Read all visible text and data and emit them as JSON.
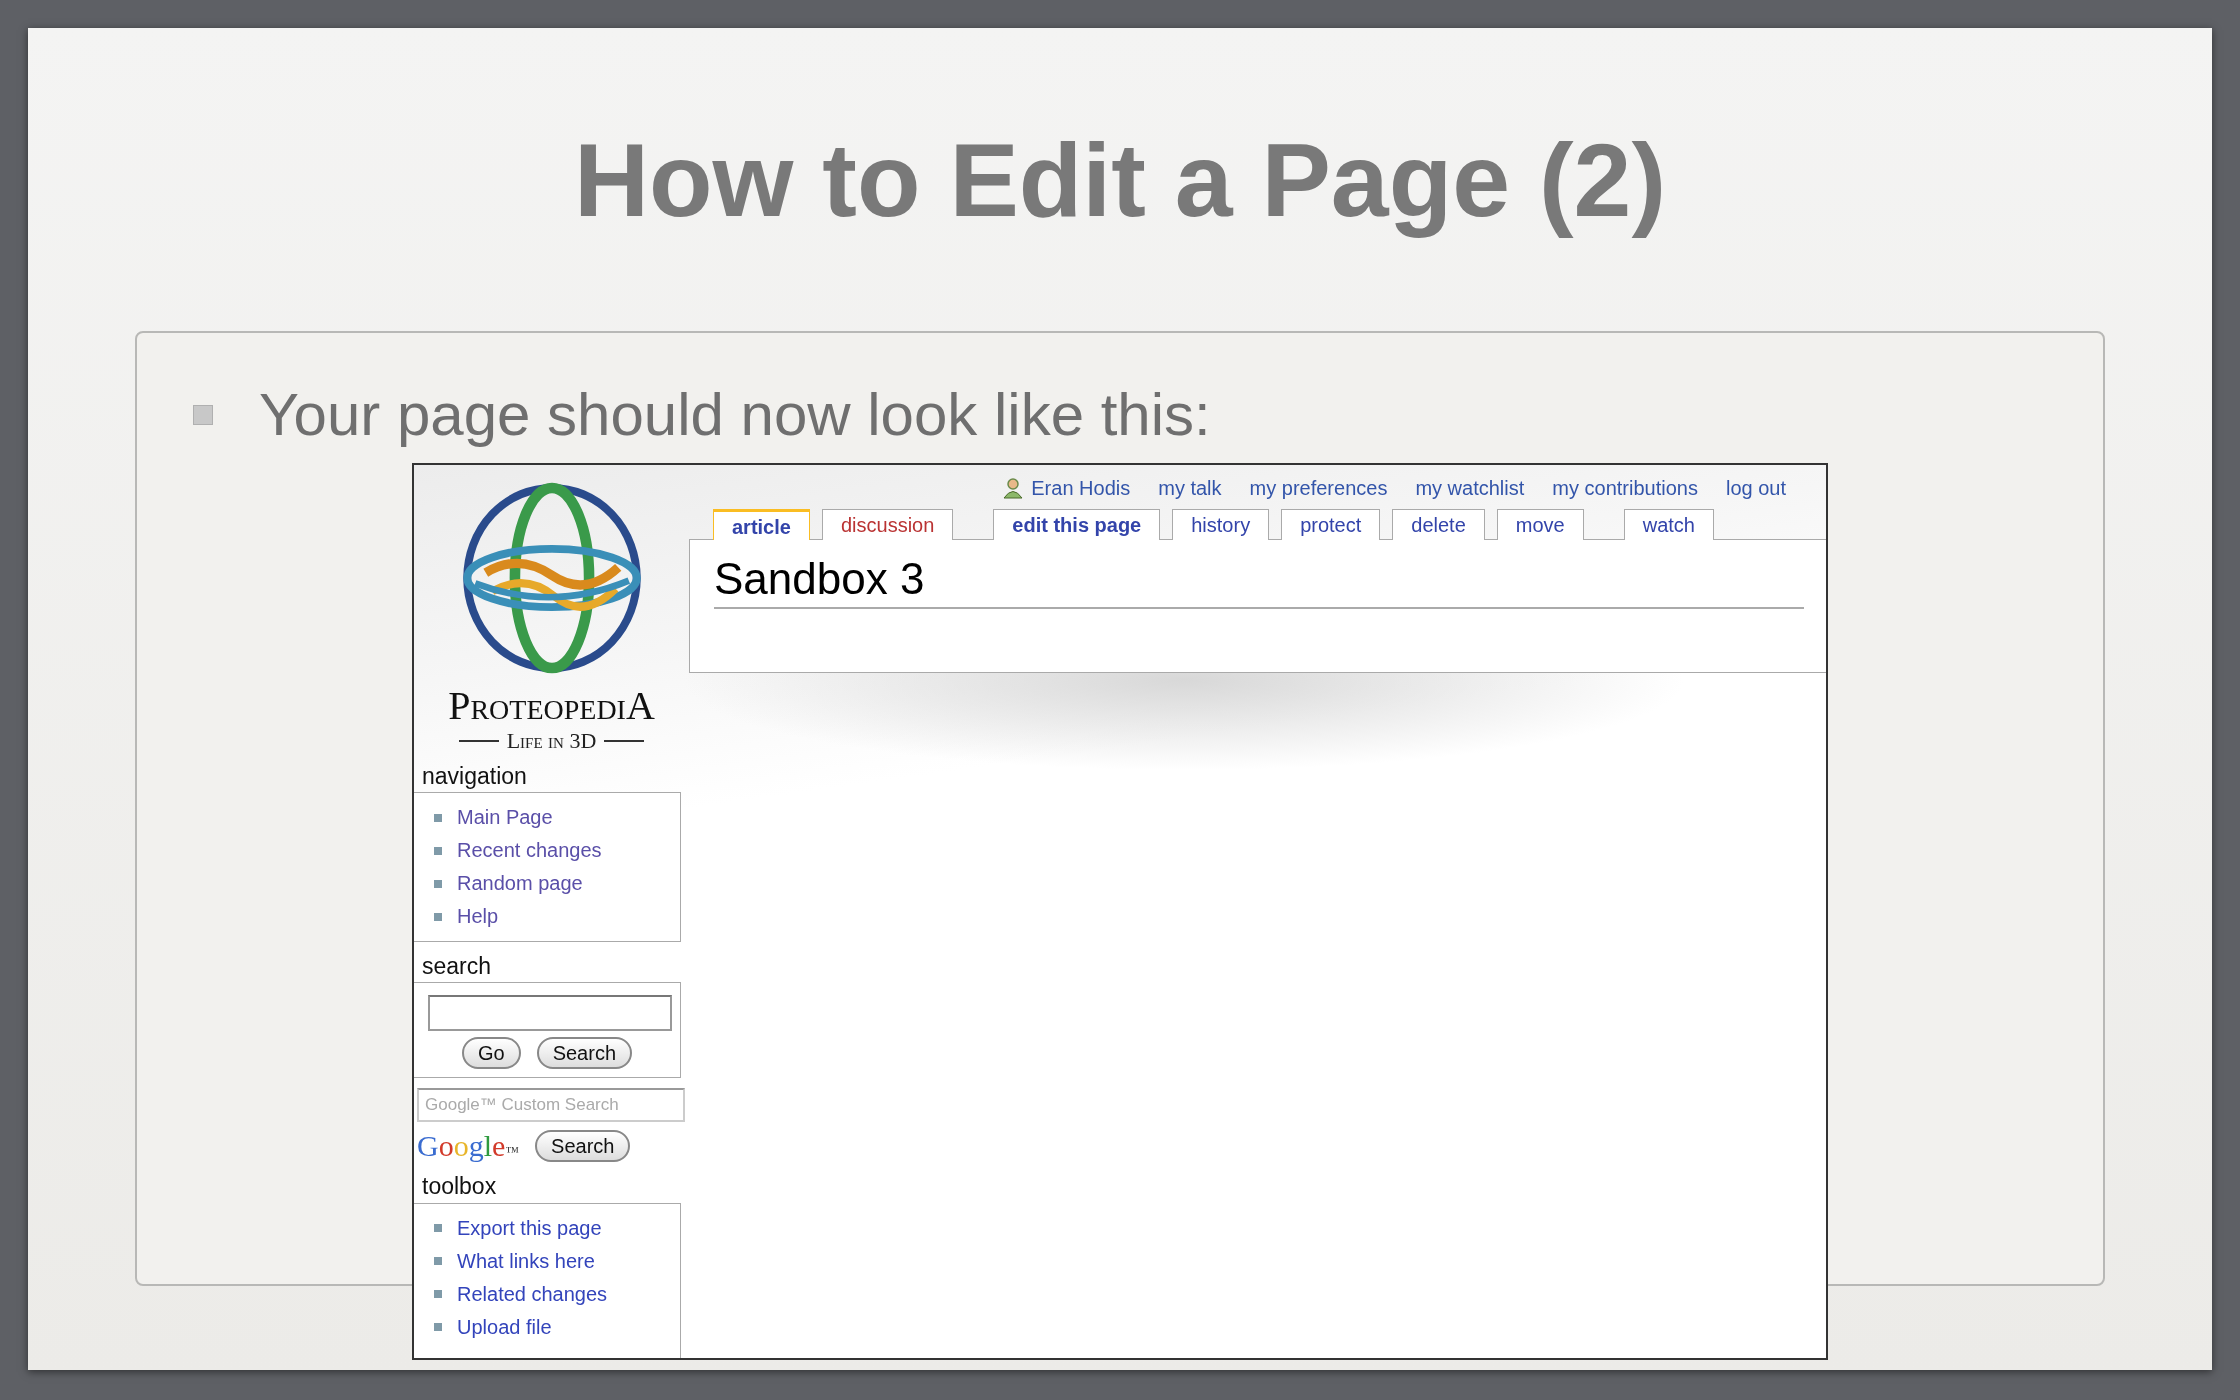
{
  "slide": {
    "title": "How to Edit a Page (2)",
    "bullet": "Your page should now look like this:"
  },
  "screenshot": {
    "logo": {
      "name": "ProteopediA",
      "tagline": "Life in 3D"
    },
    "user_links": [
      {
        "text": "Eran Hodis",
        "kind": "user"
      },
      {
        "text": "my talk",
        "kind": "link"
      },
      {
        "text": "my preferences",
        "kind": "link"
      },
      {
        "text": "my watchlist",
        "kind": "link"
      },
      {
        "text": "my contributions",
        "kind": "link"
      },
      {
        "text": "log out",
        "kind": "link"
      }
    ],
    "tab_groups": [
      [
        {
          "label": "article",
          "selected": true,
          "emphasized": true,
          "color": "#3344aa"
        },
        {
          "label": "discussion",
          "selected": false,
          "emphasized": false,
          "color": "#ba3333"
        }
      ],
      [
        {
          "label": "edit this page",
          "selected": false,
          "emphasized": true,
          "color": "#3344aa"
        },
        {
          "label": "history",
          "selected": false,
          "emphasized": false,
          "color": "#3344aa"
        },
        {
          "label": "protect",
          "selected": false,
          "emphasized": false,
          "color": "#3344aa"
        },
        {
          "label": "delete",
          "selected": false,
          "emphasized": false,
          "color": "#3344aa"
        },
        {
          "label": "move",
          "selected": false,
          "emphasized": false,
          "color": "#3344aa"
        }
      ],
      [
        {
          "label": "watch",
          "selected": false,
          "emphasized": false,
          "color": "#3344aa"
        }
      ]
    ],
    "page_title": "Sandbox 3",
    "navigation": {
      "heading": "navigation",
      "items": [
        "Main Page",
        "Recent changes",
        "Random page",
        "Help"
      ]
    },
    "search": {
      "heading": "search",
      "buttons": [
        "Go",
        "Search"
      ]
    },
    "google_search": {
      "placeholder": "Google™ Custom Search",
      "logo": "Google™",
      "button": "Search"
    },
    "toolbox": {
      "heading": "toolbox",
      "items": [
        "Export this page",
        "What links here",
        "Related changes",
        "Upload file"
      ]
    }
  }
}
